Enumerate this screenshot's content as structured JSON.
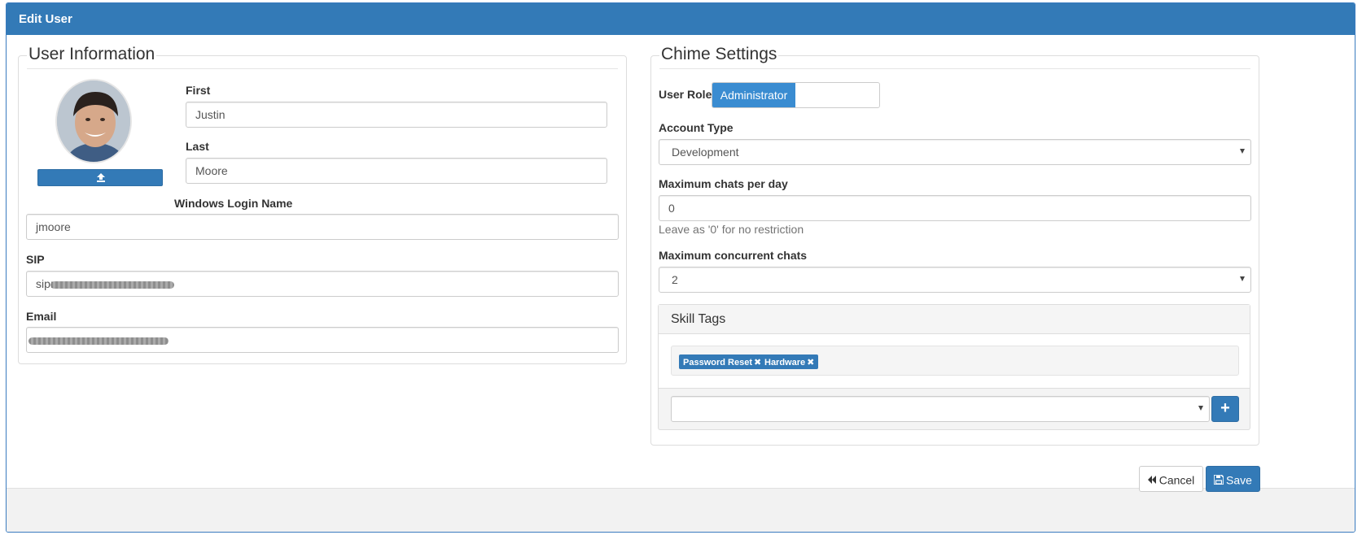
{
  "dialog": {
    "title": "Edit User"
  },
  "user_info": {
    "legend": "User Information",
    "first_label": "First",
    "first_value": "Justin",
    "last_label": "Last",
    "last_value": "Moore",
    "windows_label": "Windows Login Name",
    "windows_value": "jmoore",
    "sip_label": "SIP",
    "sip_value_visible": "sip:",
    "email_label": "Email",
    "upload_icon": "upload-icon"
  },
  "chime": {
    "legend": "Chime Settings",
    "role_label": "User Role:",
    "role_value": "Administrator",
    "account_type_label": "Account Type",
    "account_type_value": "Development",
    "max_chats_label": "Maximum chats per day",
    "max_chats_value": "0",
    "max_chats_help": "Leave as '0' for no restriction",
    "max_concurrent_label": "Maximum concurrent chats",
    "max_concurrent_value": "2",
    "skill_tags": {
      "title": "Skill Tags",
      "tags": [
        "Password Reset",
        "Hardware"
      ],
      "remove_icon": "times-icon",
      "add_value": "",
      "add_icon": "plus-icon"
    }
  },
  "footer": {
    "cancel_label": "Cancel",
    "cancel_icon": "backward-icon",
    "save_label": "Save",
    "save_icon": "floppy-disk-icon"
  },
  "colors": {
    "primary": "#337ab7",
    "header": "#337ab7",
    "footer_bg": "#f2f2f2"
  }
}
